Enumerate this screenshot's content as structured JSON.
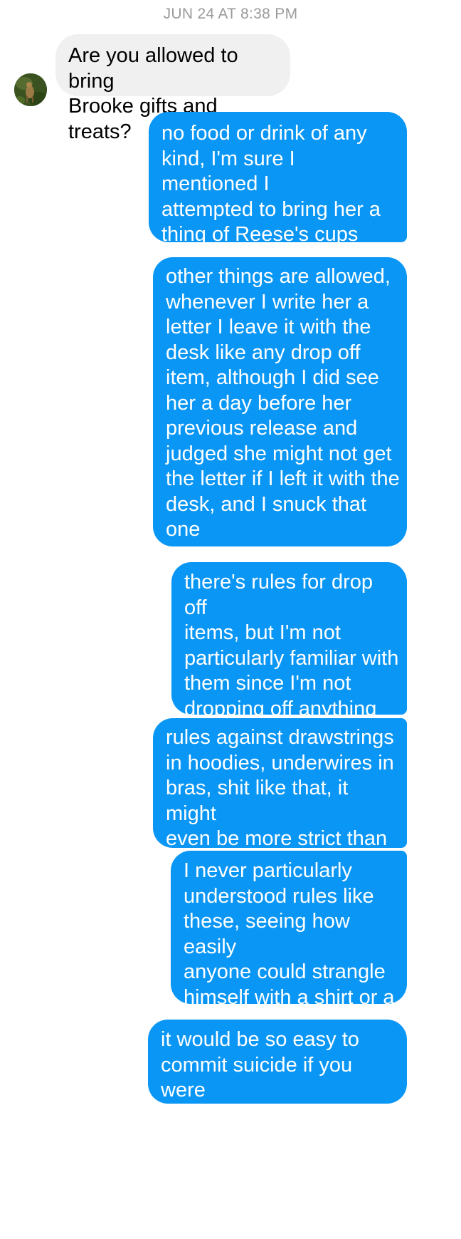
{
  "thread": {
    "timestamp": "JUN 24 AT 8:38 PM",
    "incoming_avatar_icon": "contact-avatar",
    "colors": {
      "outgoing_bubble": "#0a96f5",
      "incoming_bubble": "#f0f0f0",
      "timestamp": "#9a9a9a"
    },
    "messages": [
      {
        "direction": "incoming",
        "text": "Are you allowed to bring\nBrooke gifts and treats?"
      },
      {
        "direction": "outgoing",
        "text": "no food or drink of any\nkind, I'm sure I mentioned I\nattempted to bring her a\nthing of Reese's cups and\nit was denied"
      },
      {
        "direction": "outgoing",
        "text": "other things are allowed,\nwhenever I write her a\nletter I leave it with the\ndesk like any drop off\nitem, although I did see\nher a day before her\nprevious release and\njudged she might not get\nthe letter if I left it with the\ndesk, and I snuck that one\nstraight to her during the\nvisit"
      },
      {
        "direction": "outgoing",
        "text": "there's rules for drop off\nitems, but I'm not\nparticularly familiar with\nthem since I'm not\ndropping off anything\ncomplex"
      },
      {
        "direction": "outgoing",
        "text": "rules against drawstrings\nin hoodies, underwires in\nbras, shit like that, it might\neven be more strict than\nthat"
      },
      {
        "direction": "outgoing",
        "text": "I never particularly\nunderstood rules like\nthese, seeing how easily\nanyone could strangle\nhimself with a shirt or a\npair of pants"
      },
      {
        "direction": "outgoing",
        "text": "it would be so easy to\ncommit suicide if you were\nreally determined to do it"
      }
    ]
  }
}
